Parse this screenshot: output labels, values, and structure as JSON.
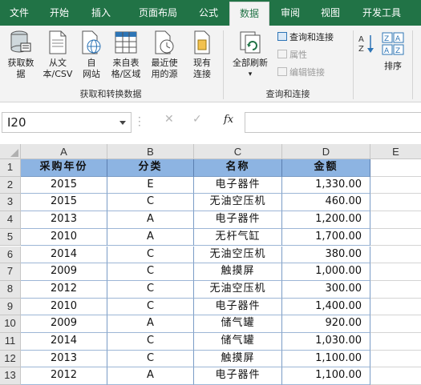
{
  "tabs": [
    {
      "label": "文件",
      "active": false
    },
    {
      "label": "开始",
      "active": false
    },
    {
      "label": "插入",
      "active": false
    },
    {
      "label": "页面布局",
      "active": false
    },
    {
      "label": "公式",
      "active": false
    },
    {
      "label": "数据",
      "active": true
    },
    {
      "label": "审阅",
      "active": false
    },
    {
      "label": "视图",
      "active": false
    },
    {
      "label": "开发工具",
      "active": false
    }
  ],
  "ribbon": {
    "get_data_label_1": "获取数",
    "get_data_label_2": "据",
    "from_text_1": "从文",
    "from_text_2": "本/CSV",
    "from_web_1": "自",
    "from_web_2": "网站",
    "from_table_1": "来自表",
    "from_table_2": "格/区域",
    "recent_1": "最近使",
    "recent_2": "用的源",
    "existing_1": "现有",
    "existing_2": "连接",
    "group_get_transform": "获取和转换数据",
    "refresh_all_1": "全部刷新",
    "queries_connections": "查询和连接",
    "properties": "属性",
    "edit_links": "编辑链接",
    "group_queries": "查询和连接",
    "sort_label": "排序",
    "colors": {
      "brand": "#217346",
      "ribbon_bg": "#f3f3f3",
      "header_fill": "#8db4e2"
    }
  },
  "formula_bar": {
    "name_box": "I20",
    "cancel_icon": "✕",
    "enter_icon": "✓",
    "fx_label": "fx",
    "formula_value": ""
  },
  "sheet": {
    "columns": [
      "A",
      "B",
      "C",
      "D",
      "E"
    ],
    "row_numbers": [
      "1",
      "2",
      "3",
      "4",
      "5",
      "6",
      "7",
      "8",
      "9",
      "10",
      "11",
      "12",
      "13"
    ],
    "header_row": [
      "采购年份",
      "分类",
      "名称",
      "金额"
    ],
    "rows": [
      [
        "2015",
        "E",
        "电子器件",
        "1,330.00"
      ],
      [
        "2015",
        "C",
        "无油空压机",
        "460.00"
      ],
      [
        "2013",
        "A",
        "电子器件",
        "1,200.00"
      ],
      [
        "2010",
        "A",
        "无杆气缸",
        "1,700.00"
      ],
      [
        "2014",
        "C",
        "无油空压机",
        "380.00"
      ],
      [
        "2009",
        "C",
        "触摸屏",
        "1,000.00"
      ],
      [
        "2012",
        "C",
        "无油空压机",
        "300.00"
      ],
      [
        "2010",
        "C",
        "电子器件",
        "1,400.00"
      ],
      [
        "2009",
        "A",
        "储气罐",
        "920.00"
      ],
      [
        "2014",
        "C",
        "储气罐",
        "1,030.00"
      ],
      [
        "2013",
        "C",
        "触摸屏",
        "1,100.00"
      ],
      [
        "2012",
        "A",
        "电子器件",
        "1,100.00"
      ]
    ]
  }
}
